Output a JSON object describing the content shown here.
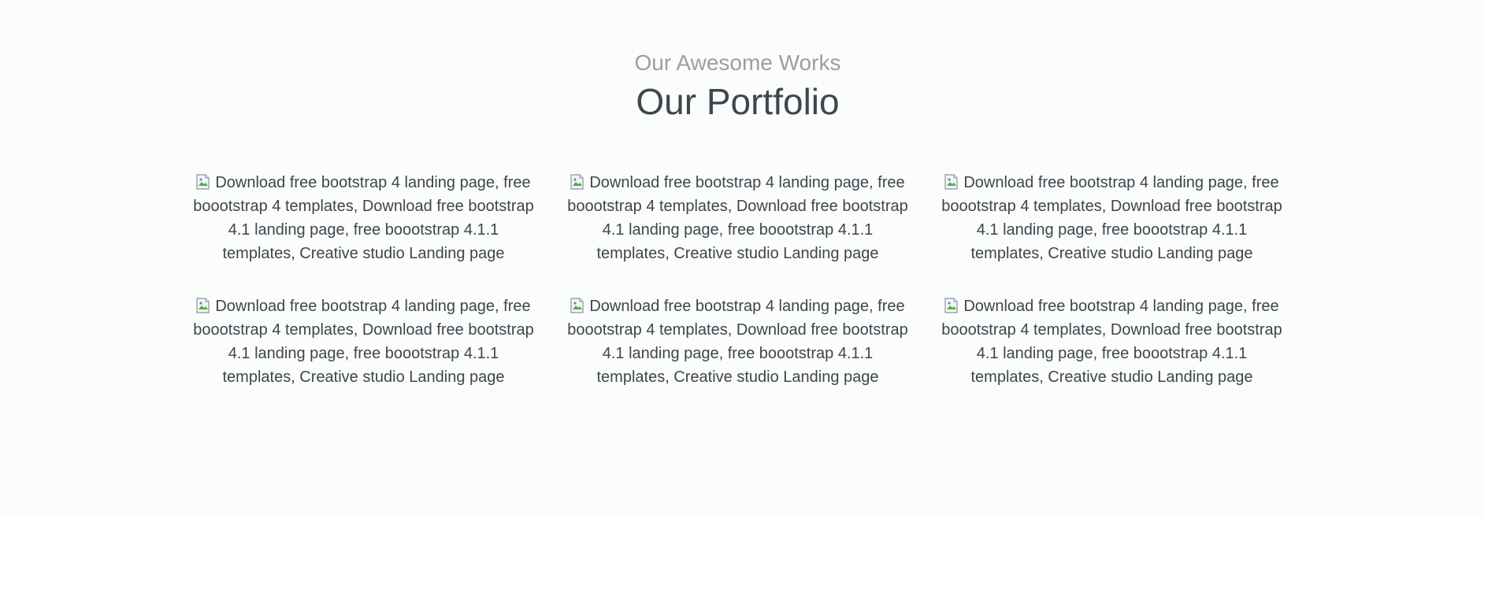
{
  "portfolio": {
    "subtitle": "Our Awesome Works",
    "title": "Our Portfolio",
    "items": [
      {
        "alt": "Download free bootstrap 4 landing page, free boootstrap 4 templates, Download free bootstrap 4.1 landing page, free boootstrap 4.1.1 templates, Creative studio Landing page"
      },
      {
        "alt": "Download free bootstrap 4 landing page, free boootstrap 4 templates, Download free bootstrap 4.1 landing page, free boootstrap 4.1.1 templates, Creative studio Landing page"
      },
      {
        "alt": "Download free bootstrap 4 landing page, free boootstrap 4 templates, Download free bootstrap 4.1 landing page, free boootstrap 4.1.1 templates, Creative studio Landing page"
      },
      {
        "alt": "Download free bootstrap 4 landing page, free boootstrap 4 templates, Download free bootstrap 4.1 landing page, free boootstrap 4.1.1 templates, Creative studio Landing page"
      },
      {
        "alt": "Download free bootstrap 4 landing page, free boootstrap 4 templates, Download free bootstrap 4.1 landing page, free boootstrap 4.1.1 templates, Creative studio Landing page"
      },
      {
        "alt": "Download free bootstrap 4 landing page, free boootstrap 4 templates, Download free bootstrap 4.1 landing page, free boootstrap 4.1.1 templates, Creative studio Landing page"
      }
    ]
  },
  "colors": {
    "section_background": "#fbfcfc",
    "title": "#3f464d",
    "subtitle": "#9a9fa5",
    "body_text": "#3e454c",
    "scrollbar_thumb": "#8d9094"
  },
  "icons": {
    "portfolio_image": "broken-image-icon"
  }
}
